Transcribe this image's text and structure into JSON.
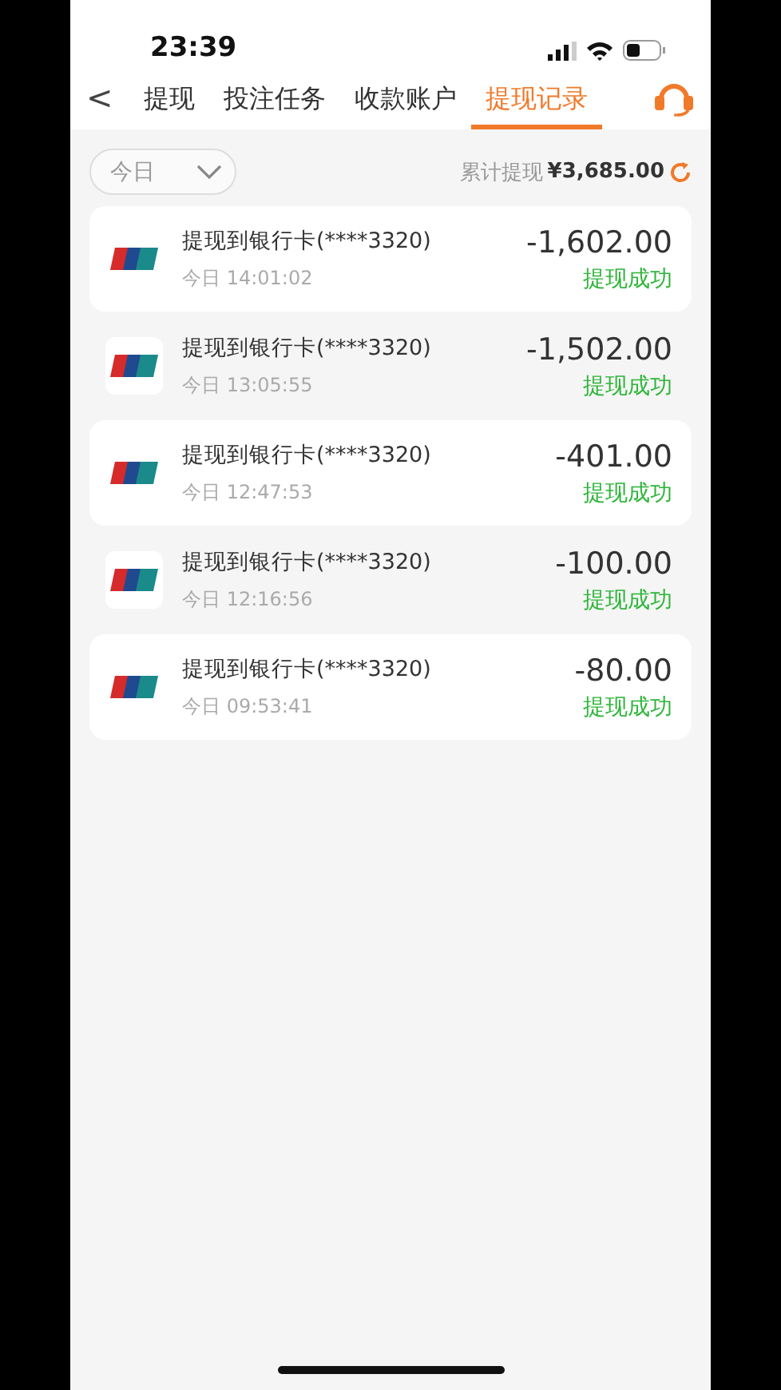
{
  "status_bar": {
    "time": "23:39"
  },
  "nav": {
    "back": "<",
    "tabs": [
      {
        "label": "提现",
        "selected": false
      },
      {
        "label": "投注任务",
        "selected": false
      },
      {
        "label": "收款账户",
        "selected": false
      },
      {
        "label": "提现记录",
        "selected": true
      }
    ]
  },
  "filter": {
    "period": "今日",
    "total_label": "累计提现",
    "total": "¥3,685.00"
  },
  "records": [
    {
      "title": "提现到银行卡(****3320)",
      "time": "今日 14:01:02",
      "amount": "-1,602.00",
      "status": "提现成功"
    },
    {
      "title": "提现到银行卡(****3320)",
      "time": "今日 13:05:55",
      "amount": "-1,502.00",
      "status": "提现成功"
    },
    {
      "title": "提现到银行卡(****3320)",
      "time": "今日 12:47:53",
      "amount": "-401.00",
      "status": "提现成功"
    },
    {
      "title": "提现到银行卡(****3320)",
      "time": "今日 12:16:56",
      "amount": "-100.00",
      "status": "提现成功"
    },
    {
      "title": "提现到银行卡(****3320)",
      "time": "今日 09:53:41",
      "amount": "-80.00",
      "status": "提现成功"
    }
  ]
}
